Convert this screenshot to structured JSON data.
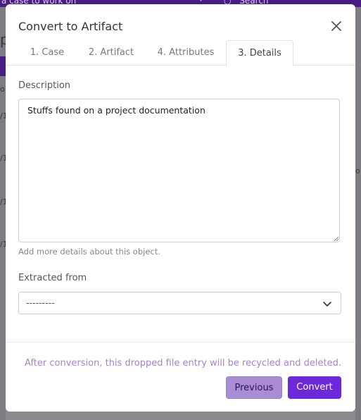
{
  "background": {
    "case_select_text": "a case to work on",
    "search_text": "Search",
    "left_fragments": [
      "p",
      "o",
      "/1",
      "/1",
      "/1",
      "/1"
    ],
    "right_fragment": "o"
  },
  "modal": {
    "title": "Convert to Artifact",
    "tabs": [
      {
        "label": "1. Case"
      },
      {
        "label": "2. Artifact"
      },
      {
        "label": "4. Attributes"
      },
      {
        "label": "3. Details"
      }
    ],
    "active_tab": "3. Details",
    "description": {
      "label": "Description",
      "value": "Stuffs found on a project documentation",
      "help": "Add more details about this object."
    },
    "extracted_from": {
      "label": "Extracted from",
      "selected": "---------"
    },
    "footer": {
      "note": "After conversion, this dropped file entry will be recycled and deleted.",
      "previous_label": "Previous",
      "convert_label": "Convert"
    }
  },
  "colors": {
    "accent": "#6d28d9",
    "accent_light": "#a98bd6",
    "note_text": "#a283cf",
    "topbar": "#4a1d86"
  }
}
